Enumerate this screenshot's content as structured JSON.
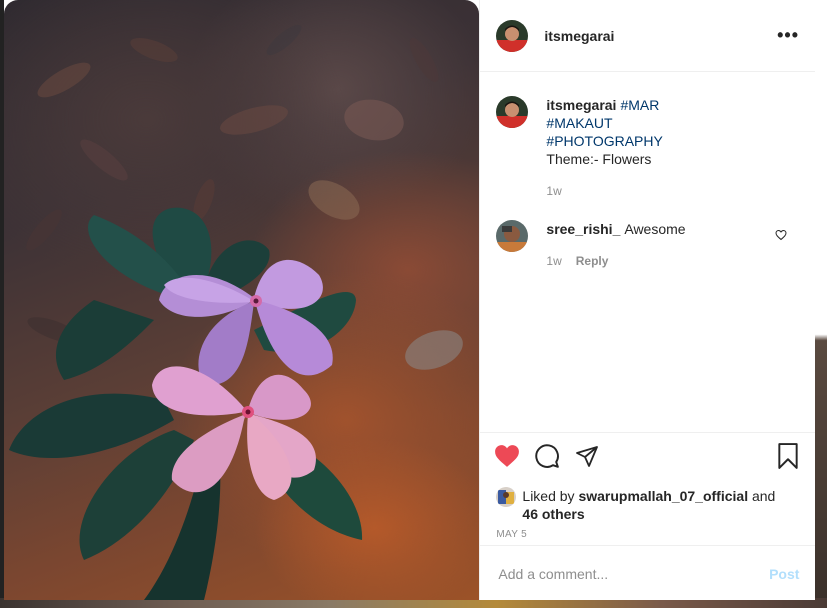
{
  "post": {
    "author": "itsmegarai",
    "more_icon": "more-horizontal-icon",
    "caption": {
      "username": "itsmegarai",
      "tags": [
        "#MAR",
        "#MAKAUT",
        "#PHOTOGRAPHY"
      ],
      "text": "Theme:- Flowers",
      "time": "1w"
    },
    "comments": [
      {
        "username": "sree_rishi_",
        "text": "Awesome",
        "time": "1w",
        "reply_label": "Reply",
        "like_icon": "heart-outline-icon"
      }
    ],
    "actions": {
      "like_icon": "heart-filled-icon",
      "comment_icon": "comment-icon",
      "share_icon": "send-icon",
      "save_icon": "bookmark-icon",
      "like_color": "#ed4956"
    },
    "likes": {
      "prefix": "Liked by",
      "user": "swarupmallah_07_official",
      "joiner": "and",
      "others": "46 others"
    },
    "date": "MAY 5",
    "add_comment": {
      "placeholder": "Add a comment...",
      "post_label": "Post"
    }
  }
}
